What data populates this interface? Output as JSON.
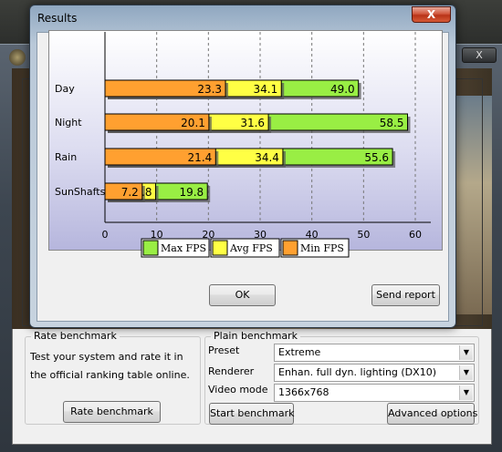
{
  "results_window": {
    "title": "Results",
    "close_glyph": "X",
    "ok_label": "OK",
    "send_report_label": "Send report"
  },
  "chart_data": {
    "type": "bar",
    "orientation": "horizontal",
    "stacking": "overlaid",
    "categories": [
      "Day",
      "Night",
      "Rain",
      "SunShafts"
    ],
    "series": [
      {
        "name": "Max FPS",
        "values": [
          49.0,
          58.5,
          55.6,
          19.8
        ],
        "color": "#99ee44"
      },
      {
        "name": "Avg FPS",
        "values": [
          34.1,
          31.6,
          34.4,
          9.8
        ],
        "color": "#ffff44"
      },
      {
        "name": "Min FPS",
        "values": [
          23.3,
          20.1,
          21.4,
          7.2
        ],
        "color": "#ffa030"
      }
    ],
    "value_labels": [
      {
        "category": "Day",
        "min": "23.3",
        "avg": "34.1",
        "max": "49.0"
      },
      {
        "category": "Night",
        "min": "20.1",
        "avg": "31.6",
        "max": "58.5"
      },
      {
        "category": "Rain",
        "min": "21.4",
        "avg": "34.4",
        "max": "55.6"
      },
      {
        "category": "SunShafts",
        "min": "7.2",
        "avg": ".8",
        "max": "19.8"
      }
    ],
    "xticks": [
      "0",
      "10",
      "20",
      "30",
      "40",
      "50",
      "60"
    ],
    "xlim": [
      0,
      63
    ],
    "grid": "vertical-dashed",
    "legend_position": "bottom",
    "legend_order": [
      "Max FPS",
      "Avg FPS",
      "Min FPS"
    ]
  },
  "rate_group": {
    "legend": "Rate benchmark",
    "description": "Test your system and rate it in the official ranking table online.",
    "button_label": "Rate benchmark"
  },
  "plain_group": {
    "legend": "Plain benchmark",
    "preset_label": "Preset",
    "preset_value": "Extreme",
    "renderer_label": "Renderer",
    "renderer_value": "Enhan. full dyn. lighting (DX10)",
    "video_mode_label": "Video mode",
    "video_mode_value": "1366x768",
    "start_label": "Start benchmark",
    "advanced_label": "Advanced options"
  },
  "parent_window": {
    "close_glyph": "X",
    "icon": "stalker-radiation-icon"
  },
  "icons": {
    "dropdown": "chevron-down-icon"
  }
}
